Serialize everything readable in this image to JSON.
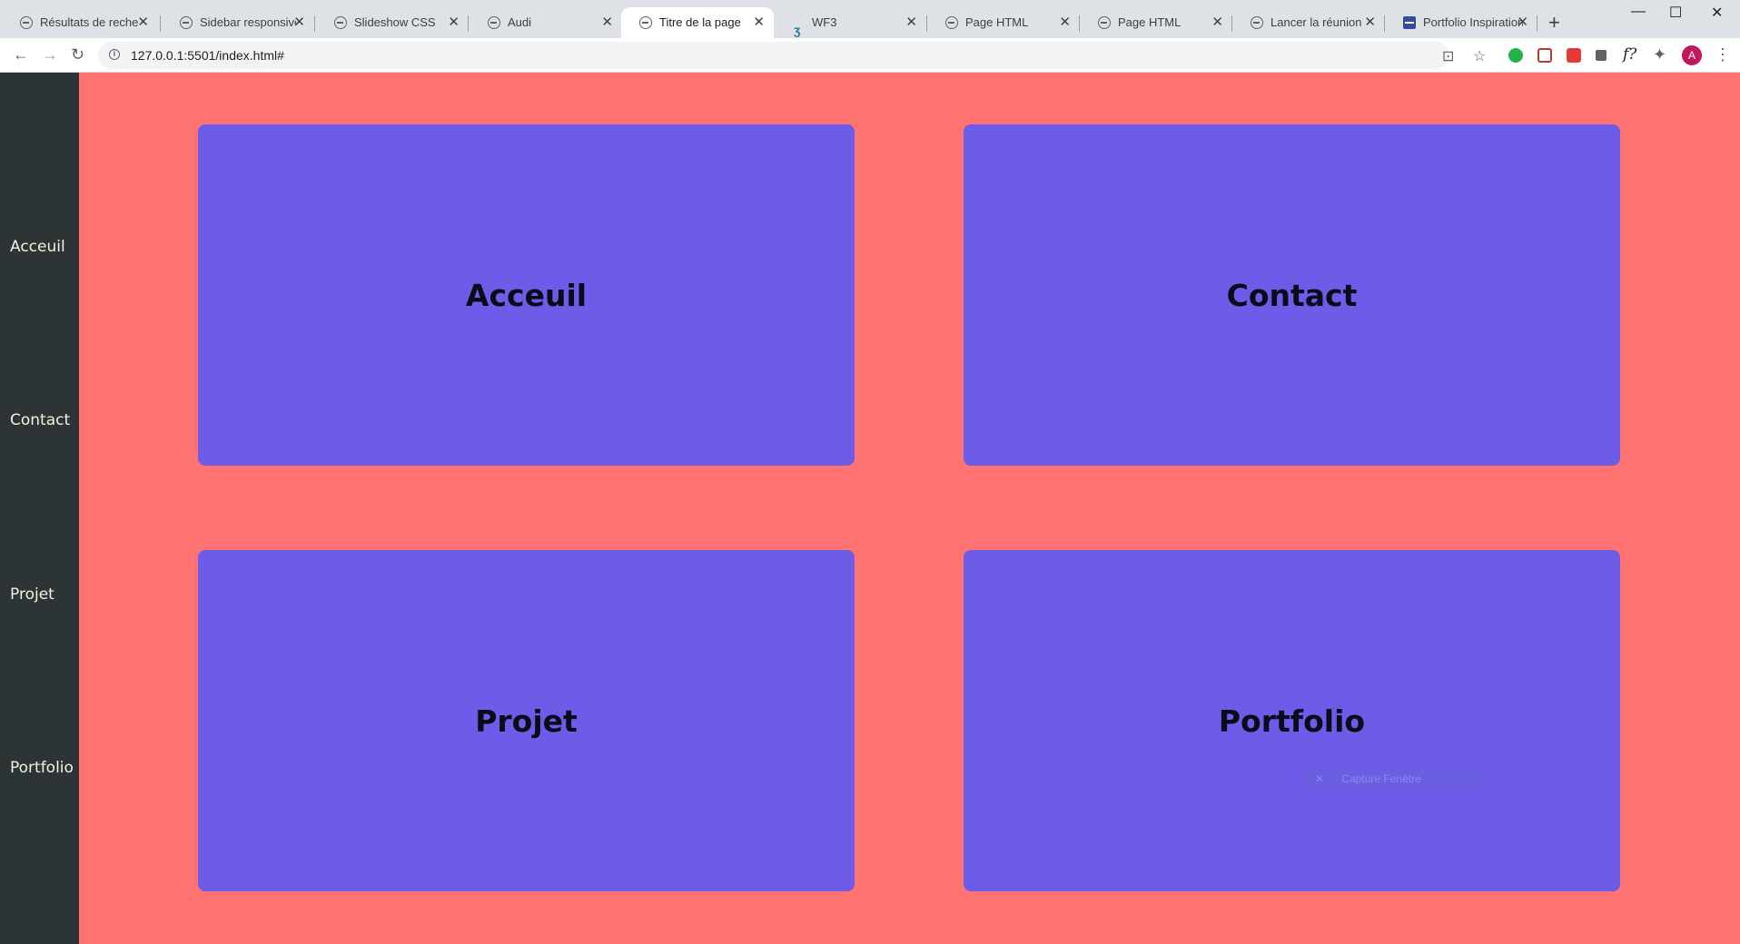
{
  "browser": {
    "tabs": [
      {
        "title": "Résultats de recherc",
        "active": false,
        "favicon": "globe-icon"
      },
      {
        "title": "Sidebar responsive",
        "active": false,
        "favicon": "globe-icon"
      },
      {
        "title": "Slideshow CSS",
        "active": false,
        "favicon": "globe-icon"
      },
      {
        "title": "Audi",
        "active": false,
        "favicon": "globe-icon"
      },
      {
        "title": "Titre de la page",
        "active": true,
        "favicon": "globe-icon"
      },
      {
        "title": "WF3",
        "active": false,
        "favicon": "wf3-icon"
      },
      {
        "title": "Page HTML",
        "active": false,
        "favicon": "globe-icon"
      },
      {
        "title": "Page HTML",
        "active": false,
        "favicon": "globe-icon"
      },
      {
        "title": "Lancer la réunion -",
        "active": false,
        "favicon": "globe-icon"
      },
      {
        "title": "Portfolio Inspiration",
        "active": false,
        "favicon": "portfolio-icon"
      }
    ],
    "tab_close_glyph": "✕",
    "new_tab_glyph": "+",
    "window_controls": {
      "minimize": "—",
      "maximize": "☐",
      "close": "✕"
    },
    "nav": {
      "back": "←",
      "forward": "→",
      "reload": "↻"
    },
    "url": "127.0.0.1:5501/index.html#",
    "url_info": "i",
    "toolbar_right": {
      "translate": "⊡",
      "bookmark": "☆",
      "extensions": "✦",
      "menu": "⋮",
      "avatar": "A",
      "fx": "f?"
    }
  },
  "sidebar": {
    "links": [
      "Acceuil",
      "Contact",
      "Projet",
      "Portfolio"
    ]
  },
  "cards": [
    "Acceuil",
    "Contact",
    "Projet",
    "Portfolio"
  ],
  "overlay_toast": {
    "icon": "✕",
    "text": "Capture Fenêtre"
  },
  "colors": {
    "page_bg": "#ff7373",
    "sidebar_bg": "#2d3436",
    "card_bg": "#6c5ce7",
    "card_text": "#0b0b1a",
    "sidebar_text": "#f5f0e0"
  }
}
